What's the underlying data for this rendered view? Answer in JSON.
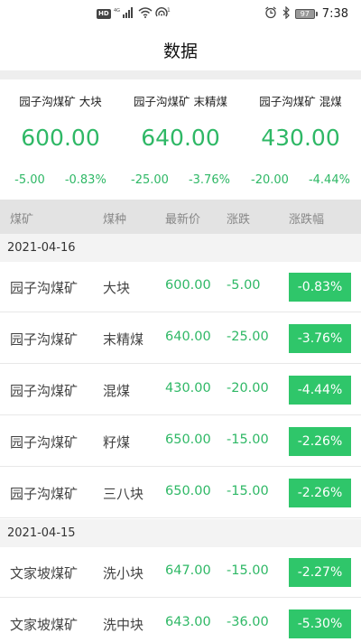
{
  "status_bar": {
    "hd": "HD",
    "network": "4G",
    "hotspot_count": "1",
    "battery": "97",
    "time": "7:38"
  },
  "header": {
    "title": "数据"
  },
  "summary": [
    {
      "title": "园子沟煤矿 大块",
      "price": "600.00",
      "change": "-5.00",
      "change_pct": "-0.83%"
    },
    {
      "title": "园子沟煤矿 末精煤",
      "price": "640.00",
      "change": "-25.00",
      "change_pct": "-3.76%"
    },
    {
      "title": "园子沟煤矿 混煤",
      "price": "430.00",
      "change": "-20.00",
      "change_pct": "-4.44%"
    }
  ],
  "table": {
    "columns": [
      "煤矿",
      "煤种",
      "最新价",
      "涨跌",
      "涨跌幅"
    ],
    "groups": [
      {
        "date": "2021-04-16",
        "rows": [
          {
            "mine": "园子沟煤矿",
            "type": "大块",
            "price": "600.00",
            "change": "-5.00",
            "change_pct": "-0.83%"
          },
          {
            "mine": "园子沟煤矿",
            "type": "末精煤",
            "price": "640.00",
            "change": "-25.00",
            "change_pct": "-3.76%"
          },
          {
            "mine": "园子沟煤矿",
            "type": "混煤",
            "price": "430.00",
            "change": "-20.00",
            "change_pct": "-4.44%"
          },
          {
            "mine": "园子沟煤矿",
            "type": "籽煤",
            "price": "650.00",
            "change": "-15.00",
            "change_pct": "-2.26%"
          },
          {
            "mine": "园子沟煤矿",
            "type": "三八块",
            "price": "650.00",
            "change": "-15.00",
            "change_pct": "-2.26%"
          }
        ]
      },
      {
        "date": "2021-04-15",
        "rows": [
          {
            "mine": "文家坡煤矿",
            "type": "洗小块",
            "price": "647.00",
            "change": "-15.00",
            "change_pct": "-2.27%"
          },
          {
            "mine": "文家坡煤矿",
            "type": "洗中块",
            "price": "643.00",
            "change": "-36.00",
            "change_pct": "-5.30%"
          }
        ]
      }
    ]
  },
  "colors": {
    "accent_green": "#2fb866",
    "badge_green": "#2fc66a",
    "table_header_bg": "#e3e3e3",
    "section_bg": "#f3f3f3"
  }
}
